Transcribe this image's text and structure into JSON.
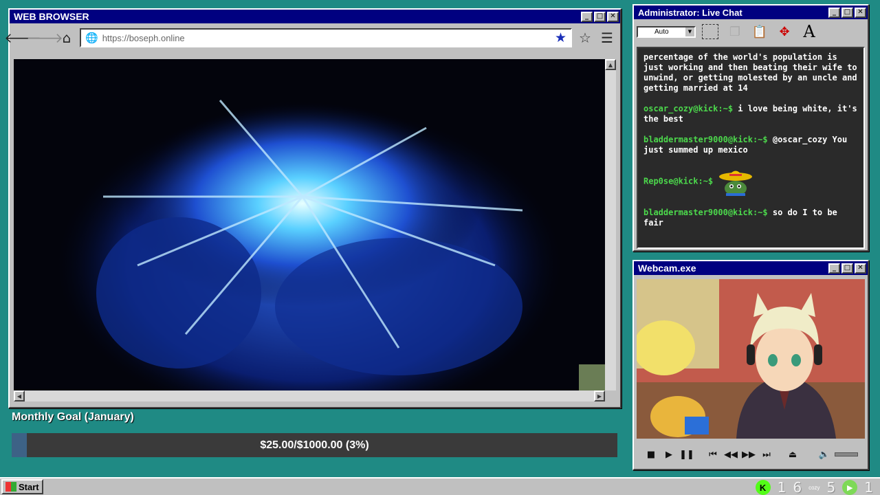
{
  "browser": {
    "title": "WEB BROWSER",
    "url": "https://boseph.online"
  },
  "goal": {
    "title": "Monthly Goal (January)",
    "text": "$25.00/$1000.00 (3%)",
    "progress_fraction": 0.025
  },
  "chat": {
    "title": "Administrator: Live Chat",
    "font_size_select": "Auto",
    "messages": [
      {
        "user": "",
        "text": "percentage of the world's population is just working and then beating their wife to unwind, or getting molested by an uncle and getting married at 14"
      },
      {
        "user": "oscar_cozy@kick:~$",
        "text": "i love being white, it's the best"
      },
      {
        "user": "bladdermaster9000@kick:~$",
        "text": "@oscar_cozy You just summed up mexico"
      },
      {
        "user": "Rep0se@kick:~$",
        "text": "",
        "emote": "sombrero-emote"
      },
      {
        "user": "bladdermaster9000@kick:~$",
        "text": "so do I to be fair"
      }
    ]
  },
  "webcam": {
    "title": "Webcam.exe"
  },
  "taskbar": {
    "start_label": "Start",
    "tray_values": [
      "1",
      "6",
      "5",
      "1"
    ],
    "tray_tiny": "cozy"
  }
}
